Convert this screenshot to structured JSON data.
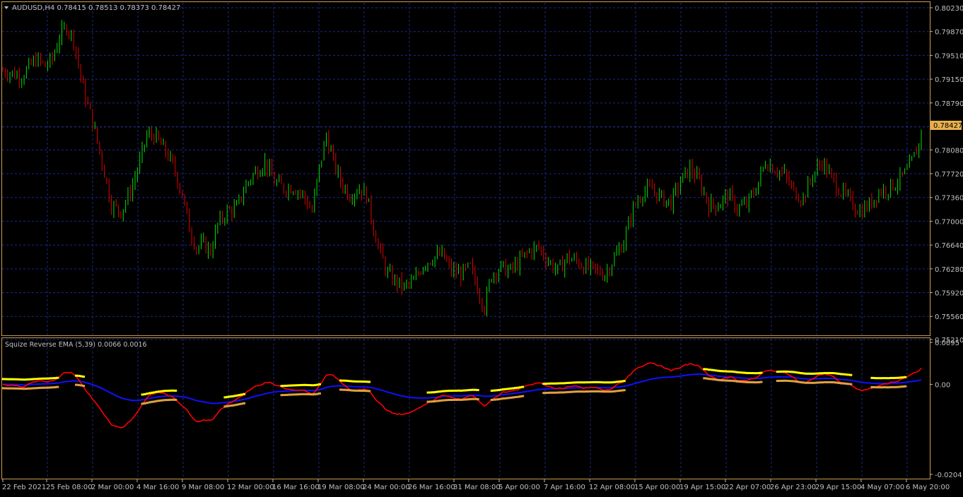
{
  "main_panel": {
    "symbol_info": "AUDUSD,H4  0.78415 0.78513 0.78373 0.78427",
    "current_price_label": "0.78427",
    "price_axis_labels": [
      "0.80230",
      "0.79870",
      "0.79510",
      "0.79150",
      "0.78790",
      "0.78080",
      "0.77720",
      "0.77360",
      "0.77000",
      "0.76640",
      "0.76280",
      "0.75920",
      "0.75560",
      "0.75210"
    ]
  },
  "indicator_panel": {
    "title": "Squize Reverse EMA (5,39) 0.0066 0.0016",
    "axis_labels": [
      "0.0095",
      "0.00",
      "-0.0204"
    ]
  },
  "time_axis_labels": [
    "22 Feb 2021",
    "25 Feb 08:00",
    "2 Mar 00:00",
    "4 Mar 16:00",
    "9 Mar 08:00",
    "12 Mar 00:00",
    "16 Mar 16:00",
    "19 Mar 08:00",
    "24 Mar 00:00",
    "26 Mar 16:00",
    "31 Mar 08:00",
    "5 Apr 00:00",
    "7 Apr 16:00",
    "12 Apr 08:00",
    "15 Apr 00:00",
    "19 Apr 15:00",
    "22 Apr 07:00",
    "26 Apr 23:00",
    "29 Apr 15:00",
    "4 May 07:00",
    "6 May 20:00"
  ],
  "colors": {
    "background": "#000000",
    "frame": "#c8a050",
    "grid": "#1a2a8c",
    "text": "#c0c0c0",
    "bull": "#00e000",
    "bear": "#e00000",
    "price_tag": "#e6b04a",
    "fast_line": "#ff0000",
    "slow_line": "#1010ff",
    "dot_yellow": "#ffff00",
    "dot_orange": "#e0a040"
  },
  "chart_data": {
    "type": "candlestick",
    "timeframe": "H4",
    "price_anchors": [
      [
        0,
        0.7928
      ],
      [
        8,
        0.792
      ],
      [
        14,
        0.7945
      ],
      [
        18,
        0.7935
      ],
      [
        21,
        0.7945
      ],
      [
        24,
        0.798
      ],
      [
        27,
        0.7995
      ],
      [
        30,
        0.7975
      ],
      [
        34,
        0.79
      ],
      [
        38,
        0.785
      ],
      [
        42,
        0.779
      ],
      [
        46,
        0.7725
      ],
      [
        50,
        0.7715
      ],
      [
        54,
        0.7745
      ],
      [
        58,
        0.779
      ],
      [
        61,
        0.783
      ],
      [
        64,
        0.783
      ],
      [
        67,
        0.7815
      ],
      [
        70,
        0.78
      ],
      [
        73,
        0.7775
      ],
      [
        76,
        0.774
      ],
      [
        79,
        0.769
      ],
      [
        82,
        0.766
      ],
      [
        85,
        0.7665
      ],
      [
        88,
        0.7655
      ],
      [
        91,
        0.7695
      ],
      [
        95,
        0.7715
      ],
      [
        99,
        0.772
      ],
      [
        103,
        0.7755
      ],
      [
        107,
        0.7775
      ],
      [
        111,
        0.779
      ],
      [
        115,
        0.776
      ],
      [
        119,
        0.775
      ],
      [
        123,
        0.7752
      ],
      [
        127,
        0.774
      ],
      [
        131,
        0.7715
      ],
      [
        134,
        0.778
      ],
      [
        137,
        0.783
      ],
      [
        140,
        0.779
      ],
      [
        143,
        0.776
      ],
      [
        147,
        0.774
      ],
      [
        151,
        0.775
      ],
      [
        154,
        0.774
      ],
      [
        157,
        0.769
      ],
      [
        160,
        0.765
      ],
      [
        163,
        0.762
      ],
      [
        166,
        0.761
      ],
      [
        170,
        0.76
      ],
      [
        174,
        0.7608
      ],
      [
        178,
        0.7635
      ],
      [
        182,
        0.7645
      ],
      [
        186,
        0.765
      ],
      [
        190,
        0.7625
      ],
      [
        194,
        0.762
      ],
      [
        198,
        0.763
      ],
      [
        201,
        0.76
      ],
      [
        204,
        0.757
      ],
      [
        207,
        0.762
      ],
      [
        211,
        0.763
      ],
      [
        215,
        0.7625
      ],
      [
        219,
        0.764
      ],
      [
        223,
        0.7655
      ],
      [
        227,
        0.766
      ],
      [
        231,
        0.764
      ],
      [
        235,
        0.7625
      ],
      [
        239,
        0.7645
      ],
      [
        243,
        0.764
      ],
      [
        247,
        0.763
      ],
      [
        251,
        0.7625
      ],
      [
        255,
        0.762
      ],
      [
        259,
        0.7645
      ],
      [
        263,
        0.767
      ],
      [
        267,
        0.772
      ],
      [
        271,
        0.7745
      ],
      [
        275,
        0.7748
      ],
      [
        279,
        0.7735
      ],
      [
        283,
        0.7728
      ],
      [
        287,
        0.776
      ],
      [
        291,
        0.778
      ],
      [
        295,
        0.776
      ],
      [
        299,
        0.7725
      ],
      [
        303,
        0.7725
      ],
      [
        307,
        0.774
      ],
      [
        311,
        0.772
      ],
      [
        315,
        0.7725
      ],
      [
        319,
        0.775
      ],
      [
        323,
        0.779
      ],
      [
        327,
        0.778
      ],
      [
        331,
        0.777
      ],
      [
        335,
        0.7745
      ],
      [
        339,
        0.7735
      ],
      [
        343,
        0.777
      ],
      [
        347,
        0.779
      ],
      [
        351,
        0.7765
      ],
      [
        355,
        0.7745
      ],
      [
        359,
        0.773
      ],
      [
        363,
        0.7715
      ],
      [
        367,
        0.7725
      ],
      [
        371,
        0.7745
      ],
      [
        375,
        0.775
      ],
      [
        379,
        0.776
      ],
      [
        383,
        0.7775
      ],
      [
        385,
        0.779
      ],
      [
        388,
        0.7815
      ],
      [
        389,
        0.7842
      ]
    ],
    "price_range": [
      0.7521,
      0.8023
    ],
    "indicator": {
      "name": "Squize Reverse EMA",
      "fast_period": 5,
      "slow_period": 39,
      "fast_value": 0.0066,
      "slow_value": 0.0016,
      "range": [
        -0.0204,
        0.0095
      ]
    }
  }
}
